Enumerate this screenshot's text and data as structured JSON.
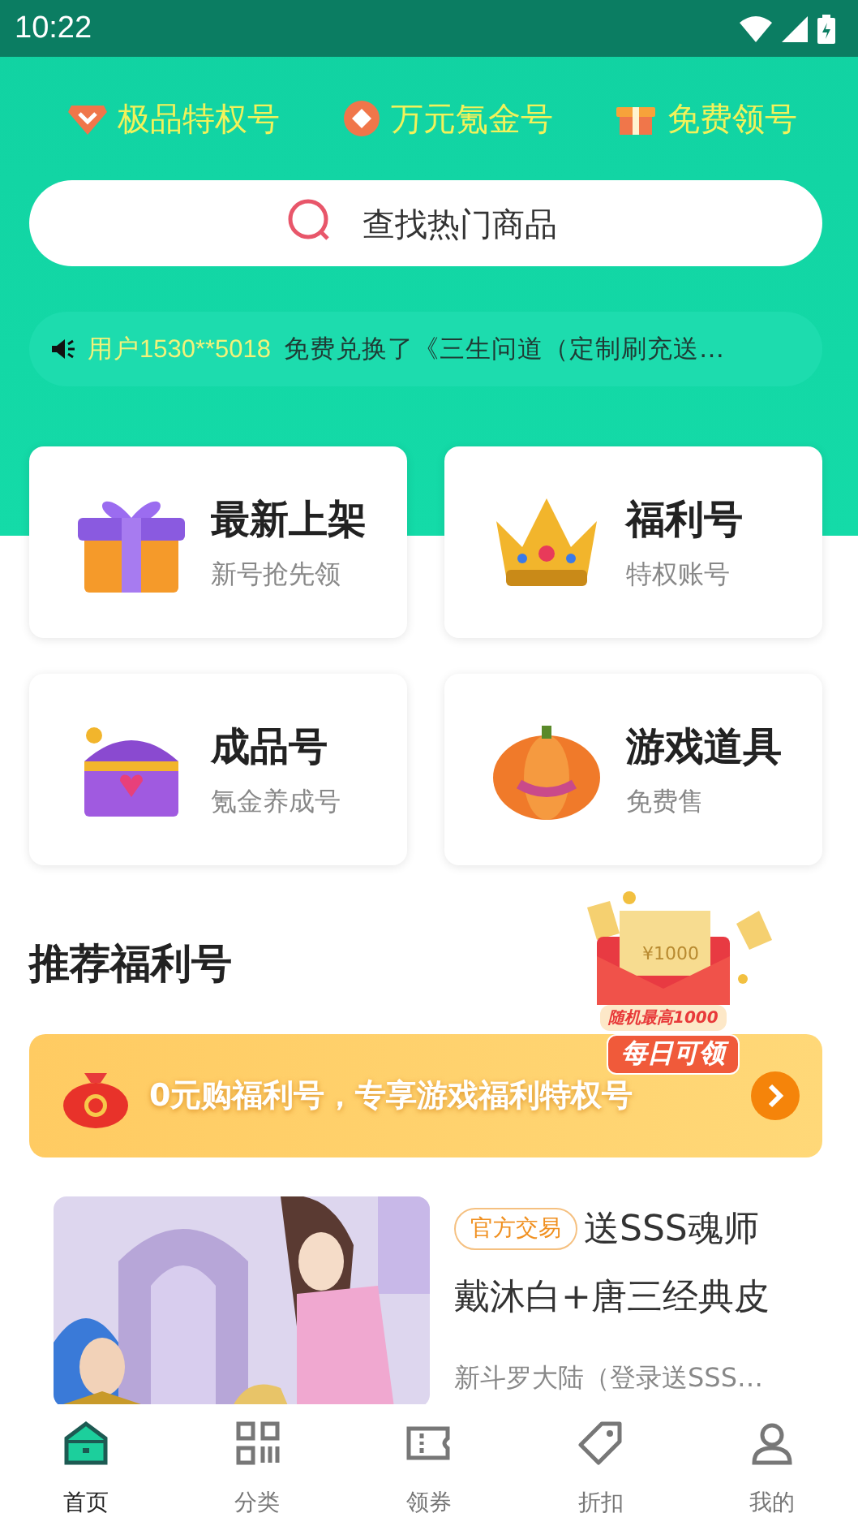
{
  "status_bar": {
    "time": "10:22"
  },
  "quick_links": [
    {
      "label": "极品特权号"
    },
    {
      "label": "万元氪金号"
    },
    {
      "label": "免费领号"
    }
  ],
  "search": {
    "placeholder": "查找热门商品"
  },
  "ticker": {
    "user": "用户1530**5018",
    "message": "免费兑换了《三生问道（定制刷充送…"
  },
  "categories": [
    {
      "title": "最新上架",
      "subtitle": "新号抢先领"
    },
    {
      "title": "福利号",
      "subtitle": "特权账号"
    },
    {
      "title": "成品号",
      "subtitle": "氪金养成号"
    },
    {
      "title": "游戏道具",
      "subtitle": "免费售"
    }
  ],
  "section_title": "推荐福利号",
  "promo": {
    "text": "0元购福利号，专享游戏福利特权号",
    "badge_small": "随机最高1000",
    "badge": "每日可领",
    "ticket": "¥1000"
  },
  "listing": {
    "tag": "官方交易",
    "title": "送SSS魂师戴沐白+唐三经典皮",
    "game": "新斗罗大陆（登录送SSS…",
    "kind": "picture"
  },
  "nav": [
    {
      "label": "首页",
      "selected": true
    },
    {
      "label": "分类",
      "selected": false
    },
    {
      "label": "领券",
      "selected": false
    },
    {
      "label": "折扣",
      "selected": false
    },
    {
      "label": "我的",
      "selected": false
    }
  ]
}
